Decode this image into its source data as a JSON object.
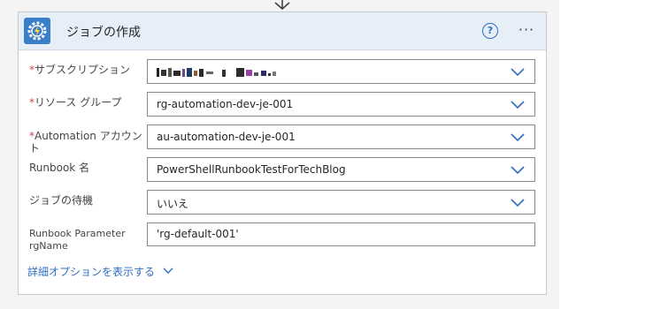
{
  "card": {
    "title": "ジョブの作成",
    "help_icon": "help-circle-icon",
    "more_label": "···",
    "app_icon": "automation-gear-bolt-icon",
    "accent_color": "#3a7dc9"
  },
  "fields": {
    "subscription": {
      "label": "サブスクリプション",
      "required": "*",
      "value": ""
    },
    "resource_group": {
      "label": "リソース グループ",
      "required": "*",
      "value": "rg-automation-dev-je-001"
    },
    "automation_account": {
      "label": "Automation アカウント",
      "required": "*",
      "value": "au-automation-dev-je-001"
    },
    "runbook": {
      "label": "Runbook 名",
      "value": "PowerShellRunbookTestForTechBlog"
    },
    "wait_for_job": {
      "label": "ジョブの待機",
      "value": "いいえ"
    },
    "runbook_param": {
      "label_line1": "Runbook Parameter",
      "label_line2": "rgName",
      "value": "'rg-default-001'"
    }
  },
  "advanced": {
    "label": "詳細オプションを表示する"
  }
}
